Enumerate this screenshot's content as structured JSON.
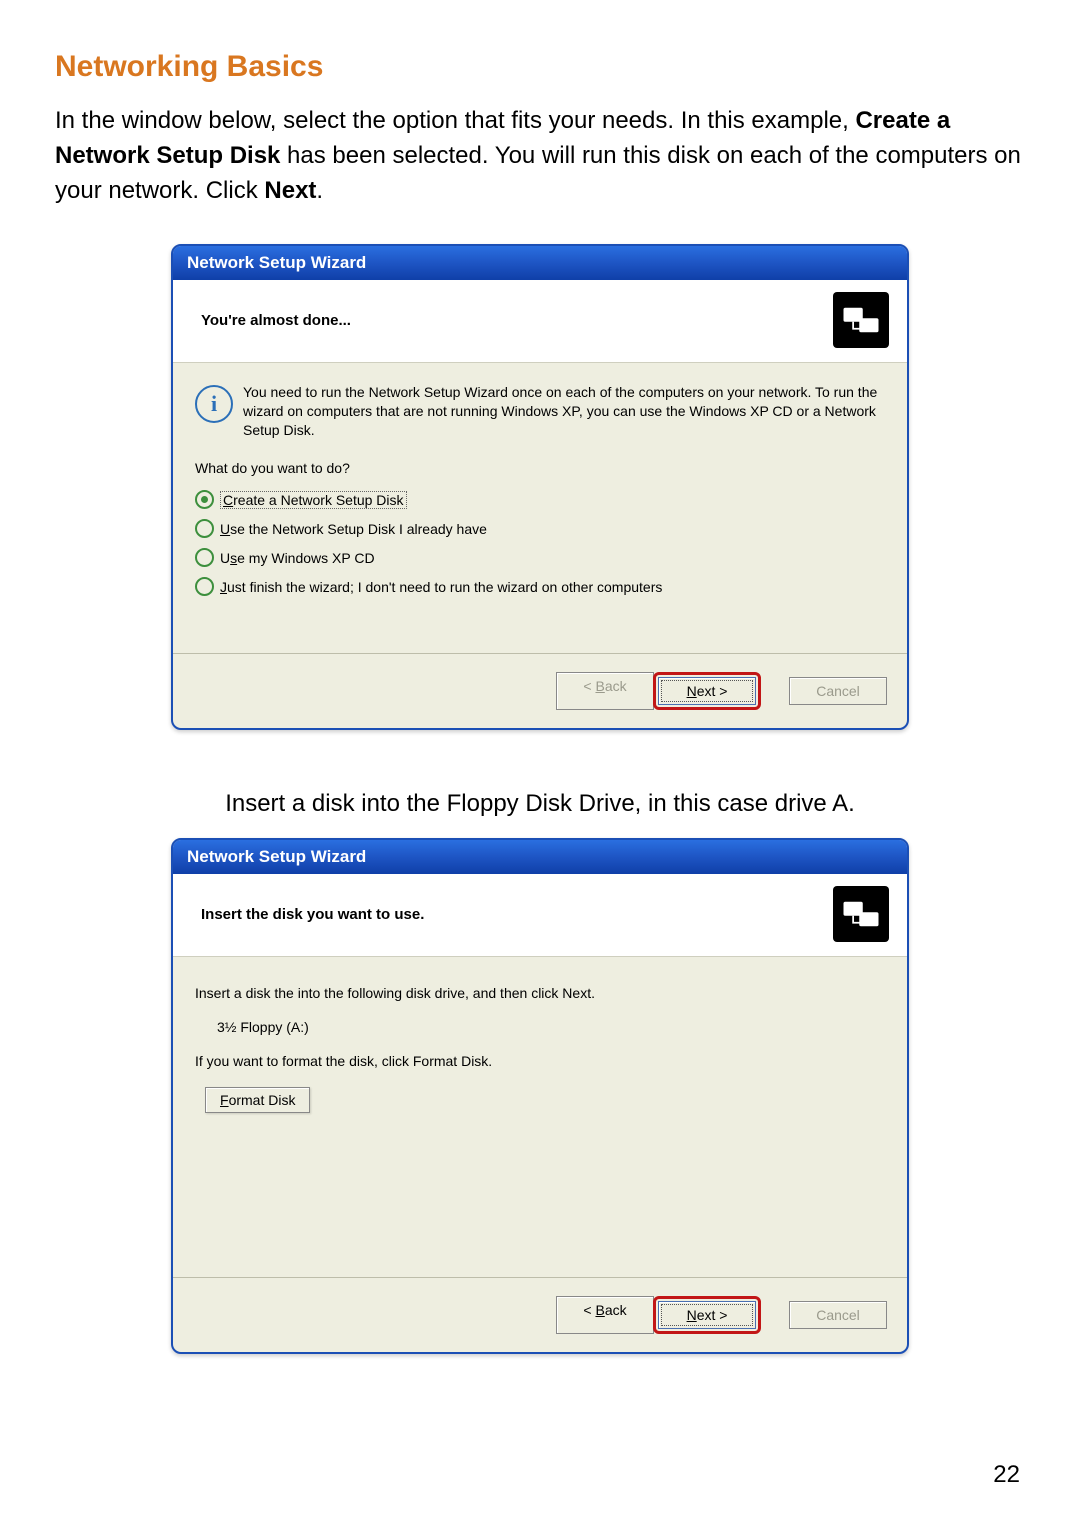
{
  "heading": "Networking Basics",
  "intro": {
    "p1a": "In the window below, select the option that fits your needs.  In this example, ",
    "p1b": "Create a Network Setup Disk",
    "p1c": " has been selected.  You will run this disk on each of the computers on your network.  Click ",
    "p1d": "Next",
    "p1e": "."
  },
  "midtext": {
    "a": "Insert a disk into the Floppy Disk Drive, in this case drive ",
    "b": "A."
  },
  "page_number": "22",
  "wizard1": {
    "title": "Network Setup Wizard",
    "subtitle": "You're almost done...",
    "info": "You need to run the Network Setup Wizard once on each of the computers on your network. To run the wizard on computers that are not running Windows XP, you can use the Windows XP CD or a Network Setup Disk.",
    "question": "What do you want to do?",
    "opt1": {
      "u": "C",
      "rest": "reate a Network Setup Disk"
    },
    "opt2": {
      "u": "U",
      "rest": "se the Network Setup Disk I already have"
    },
    "opt3": {
      "pre": "U",
      "u": "s",
      "rest": "e my Windows XP CD"
    },
    "opt4": {
      "u": "J",
      "rest": "ust finish the wizard; I don't need to run the wizard on other computers"
    },
    "buttons": {
      "back": "< Back",
      "next": "Next >",
      "cancel": "Cancel",
      "back_u": "B",
      "next_u": "N"
    }
  },
  "wizard2": {
    "title": "Network Setup Wizard",
    "subtitle": "Insert the disk you want to use.",
    "line1": "Insert a disk the into the following disk drive, and then click Next.",
    "drive": "3½ Floppy (A:)",
    "line2": "If you want to format the disk, click Format Disk.",
    "format_u": "F",
    "format_rest": "ormat Disk",
    "buttons": {
      "back": "< Back",
      "next": "Next >",
      "cancel": "Cancel",
      "back_u": "B",
      "next_u": "N"
    }
  }
}
